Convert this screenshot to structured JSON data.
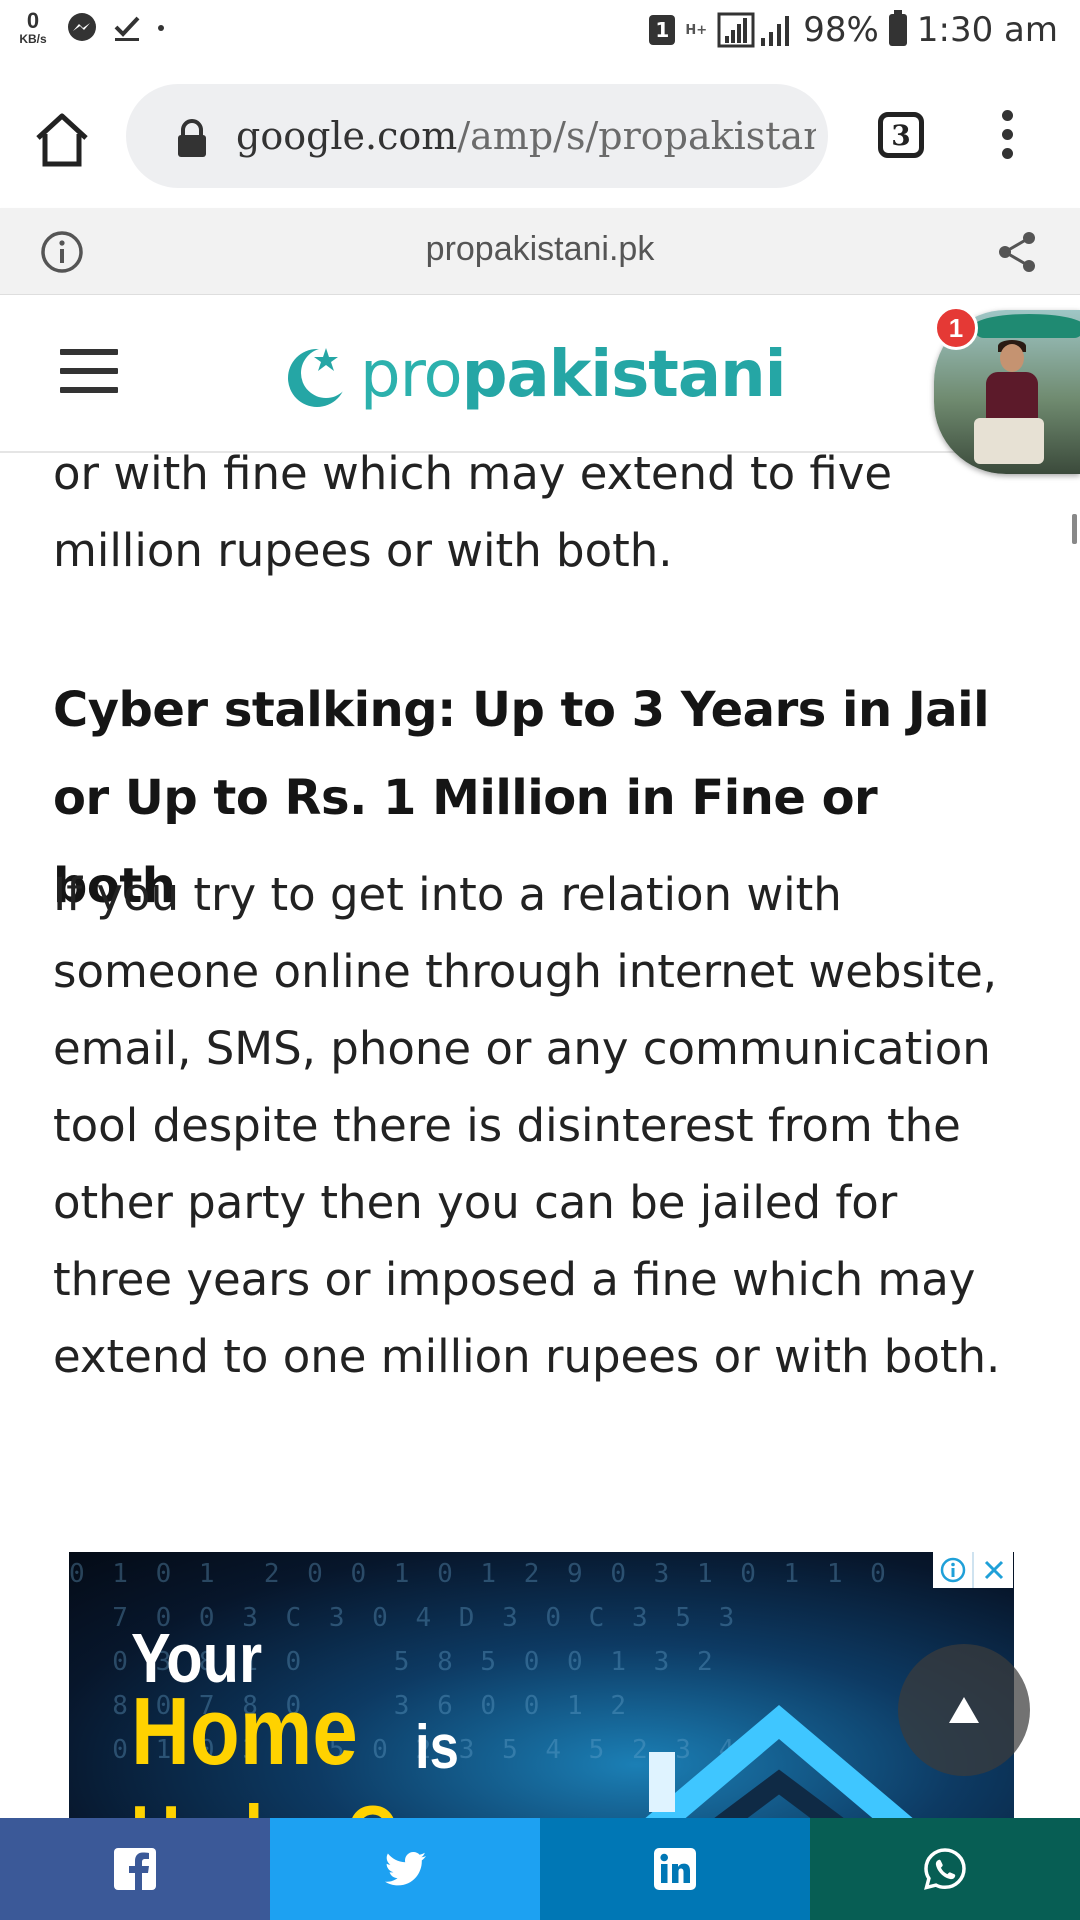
{
  "status_bar": {
    "net_speed_value": "0",
    "net_speed_unit": "KB/s",
    "sim_label": "1",
    "network_type": "H+",
    "battery": "98%",
    "time": "1:30 am",
    "icons": [
      "messenger-icon",
      "check-download-icon",
      "dot-icon",
      "signal-icon",
      "battery-icon"
    ]
  },
  "browser": {
    "url_domain": "google.com",
    "url_rest": "/amp/s/propakistani.p",
    "tab_count": "3"
  },
  "amp_bar": {
    "domain": "propakistani.pk"
  },
  "site": {
    "logo_pro": "pro",
    "logo_rest": "pakistani",
    "notification_count": "1"
  },
  "article": {
    "intro_paragraph": "or with fine which may extend to five million rupees or with both.",
    "heading": "Cyber stalking: Up to 3 Years in Jail or Up to Rs. 1 Million in Fine or both",
    "body_paragraph": "If you try to get into a relation with someone online through internet website, email, SMS, phone or any communication tool despite there is disinterest from the other party then you can be jailed for three years or imposed a fine which may extend to one million rupees or with both."
  },
  "ad": {
    "line1": "Your",
    "line2": "Home",
    "line2b": "is",
    "line3": "Under Our",
    "digits": "0 1 0 1  2 0 0 1 0 1 2 9 0 3 1 0 1 1 0\n  7 0 0 3 C 3 0 4 D 3 0 C 3 5 3\n  0 3 8 1 0    5 8 5 0 0 1 3 2\n  8 0 7 8 0    3 6 0 0 1 2\n  0 1 0 3   5 0 2 3 5 4 5 2 3 4"
  },
  "share_bar": {
    "buttons": [
      {
        "name": "facebook",
        "color": "#3b5998"
      },
      {
        "name": "twitter",
        "color": "#1da1f2"
      },
      {
        "name": "linkedin",
        "color": "#0077b5"
      },
      {
        "name": "whatsapp",
        "color": "#075e54"
      }
    ]
  },
  "colors": {
    "brand_teal": "#25a6a5",
    "ad_yellow": "#ffd200",
    "badge_red": "#e53935"
  }
}
